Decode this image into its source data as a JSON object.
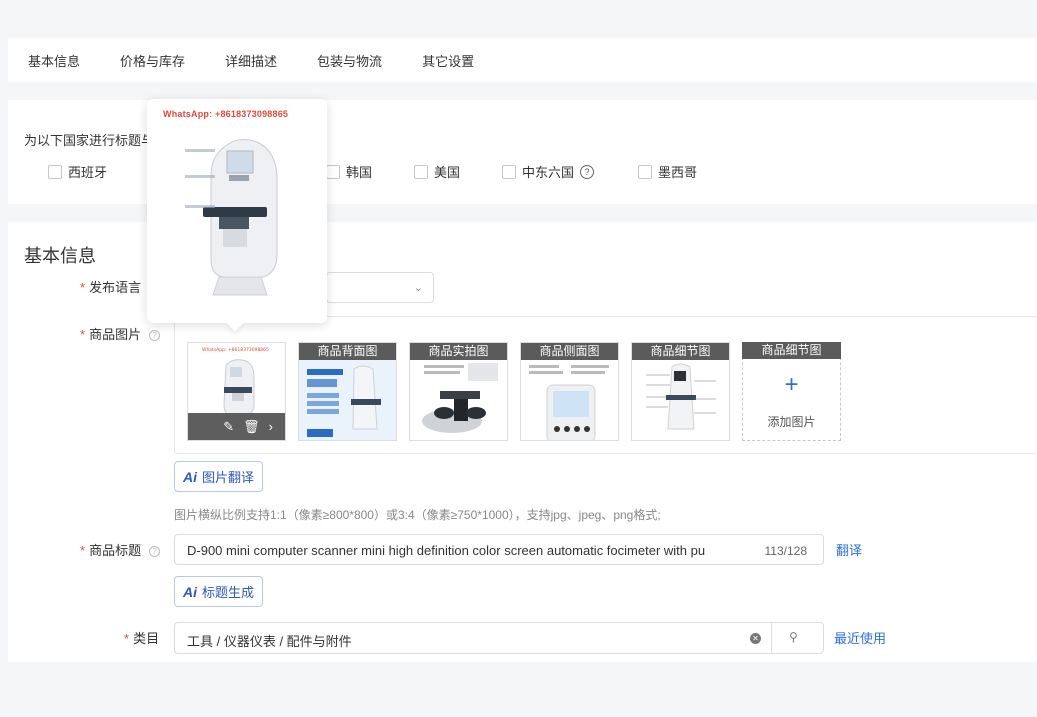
{
  "tabs": [
    "基本信息",
    "价格与库存",
    "详细描述",
    "包装与物流",
    "其它设置"
  ],
  "country": {
    "title": "为以下国家进行标题与描述等的差异化设置:",
    "items": [
      "西班牙",
      "韩国",
      "美国",
      "中东六国",
      "墨西哥"
    ],
    "help_mark": "?"
  },
  "basic": {
    "section_title": "基本信息",
    "lang_label": "发布语言",
    "images_label": "商品图片",
    "required_mark": "*",
    "help_mark": "?",
    "image_captions": [
      "商品背面图",
      "商品实拍图",
      "商品侧面图",
      "商品细节图"
    ],
    "add_caption": "商品细节图",
    "add_plus": "+",
    "add_text": "添加图片",
    "img_translate": "图片翻译",
    "ai_mark": "Ai",
    "hint": "图片横纵比例支持1:1（像素≥800*800）或3:4（像素≥750*1000），支持jpg、jpeg、png格式;",
    "title_label": "商品标题",
    "title_value": "D-900 mini computer scanner mini high definition color screen automatic focimeter with pu",
    "title_count": "113/128",
    "translate_link": "翻译",
    "title_gen": "标题生成",
    "category_label": "类目",
    "category_value": "工具 / 仪器仪表 / 配件与附件",
    "recent_link": "最近使用"
  },
  "popover": {
    "watermark": "WhatsApp: +8618373098865"
  },
  "colors": {
    "accent": "#2f6fd8",
    "required": "#e34d2f",
    "watermark": "#e0483c"
  }
}
